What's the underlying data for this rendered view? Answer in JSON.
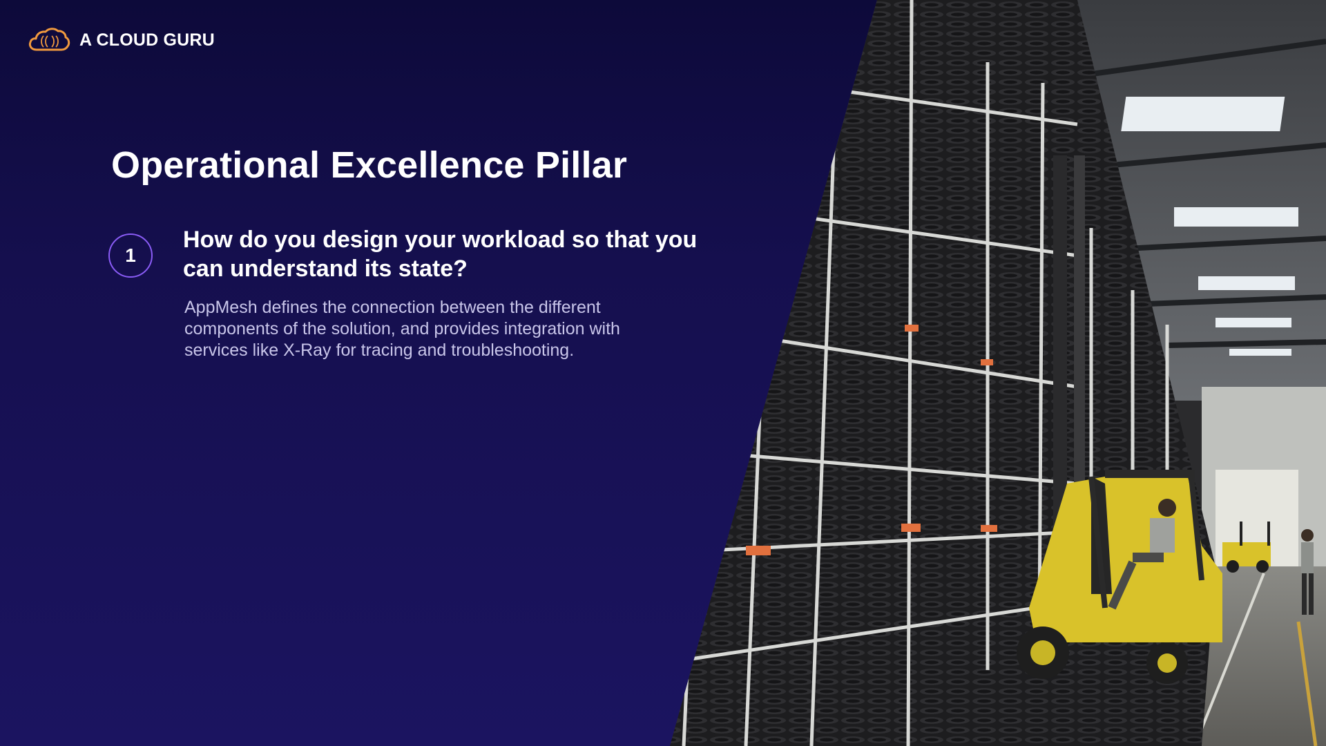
{
  "brand": {
    "name": "A CLOUD GURU",
    "accent": "#f19a3e",
    "logo_icon": "cloud-icon"
  },
  "slide": {
    "title": "Operational Excellence Pillar",
    "step_number": "1",
    "question": "How do you design your workload so that you can understand its state?",
    "answer": "AppMesh defines the connection between the different components of the solution, and provides integration with services like X-Ray for tracing and troubleshooting."
  },
  "colors": {
    "background": "#150f4e",
    "badge_ring": "#8a5cf6",
    "answer_text": "#c9c6ea"
  },
  "photo": {
    "subject": "warehouse-forklift-image"
  }
}
